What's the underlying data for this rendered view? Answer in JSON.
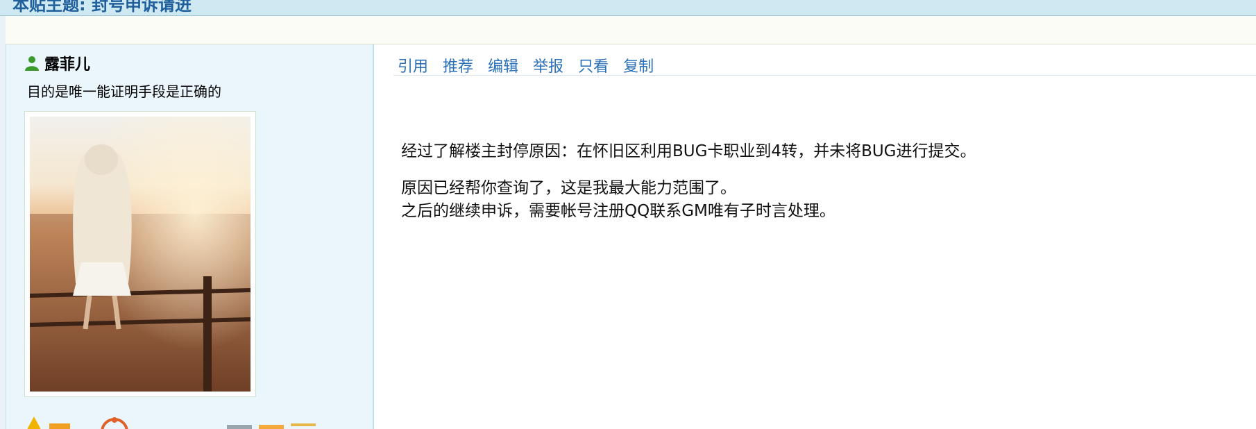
{
  "topbar": {
    "title": "本贴主题: 封号申诉请进"
  },
  "sidebar": {
    "username": "露菲儿",
    "motto": "目的是唯一能证明手段是正确的"
  },
  "actions": [
    "引用",
    "推荐",
    "编辑",
    "举报",
    "只看",
    "复制"
  ],
  "post": {
    "paragraph1": "经过了解楼主封停原因：在怀旧区利用BUG卡职业到4转，并未将BUG进行提交。",
    "paragraph2_line1": "原因已经帮你查询了，这是我最大能力范围了。",
    "paragraph2_line2": "之后的继续申诉，需要帐号注册QQ联系GM唯有子时言处理。"
  },
  "colors": {
    "link": "#2a6fb8",
    "sidebar_bg": "#eaf6fc",
    "topbar_bg": "#cfe9f2"
  }
}
